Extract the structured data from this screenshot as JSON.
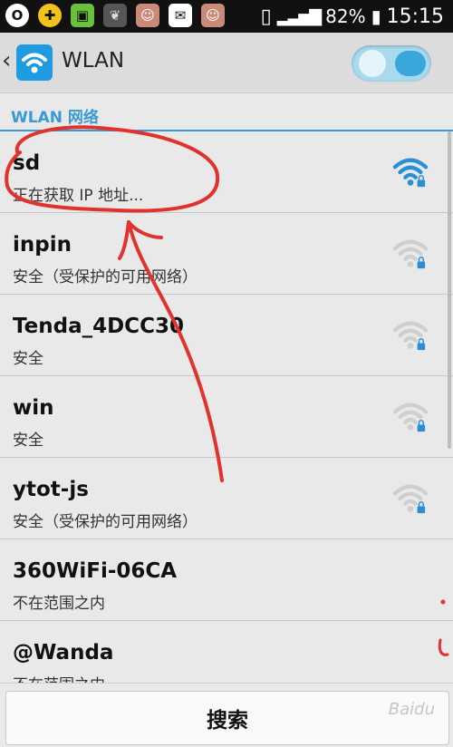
{
  "status_bar": {
    "battery": "82%",
    "time": "15:15",
    "icons": [
      "opera-icon",
      "plus-app-icon",
      "battery-green-icon",
      "leaf-icon",
      "avatar-icon",
      "wechat-icon",
      "avatar-icon",
      "phone-vibrate-icon",
      "signal-icon",
      "battery-icon"
    ]
  },
  "app_bar": {
    "title": "WLAN",
    "back_icon": "chevron-left-icon",
    "logo_icon": "wifi-app-icon",
    "toggle_state": "on"
  },
  "section": {
    "title": "WLAN 网络"
  },
  "networks": [
    {
      "name": "sd",
      "status": "正在获取 IP 地址...",
      "signal": "active"
    },
    {
      "name": "inpin",
      "status": "安全（受保护的可用网络）",
      "signal": "secure"
    },
    {
      "name": "Tenda_4DCC30",
      "status": "安全",
      "signal": "secure"
    },
    {
      "name": "win",
      "status": "安全",
      "signal": "secure"
    },
    {
      "name": "ytot-js",
      "status": "安全（受保护的可用网络）",
      "signal": "secure"
    },
    {
      "name": "360WiFi-06CA",
      "status": "不在范围之内",
      "signal": "none"
    },
    {
      "name": "@Wanda",
      "status": "不在范围之内",
      "signal": "none"
    }
  ],
  "bottom": {
    "search_label": "搜索"
  },
  "watermark": "Baidu",
  "colors": {
    "accent": "#3a9ad2",
    "annotation": "#e0332e",
    "status_bar": "#111111"
  }
}
